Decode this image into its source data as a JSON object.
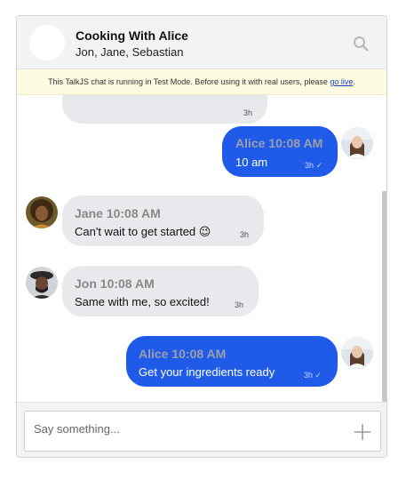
{
  "header": {
    "title": "Cooking With Alice",
    "participants": "Jon, Jane, Sebastian"
  },
  "banner": {
    "text": "This TalkJS chat is running in Test Mode. Before using it with real users, please ",
    "link": "go live",
    "suffix": "."
  },
  "messages": [
    {
      "time": "3h"
    },
    {
      "sender": "Alice",
      "time_sent": "10:08 AM",
      "text": "10 am",
      "time": "3h ✓"
    },
    {
      "sender": "Jane",
      "time_sent": "10:08 AM",
      "text": "Can't wait to get started 😉",
      "time": "3h"
    },
    {
      "sender": "Jon",
      "time_sent": "10:08 AM",
      "text": "Same with me, so excited!",
      "time": "3h"
    },
    {
      "sender": "Alice",
      "time_sent": "10:08 AM",
      "text": "Get your ingredients ready",
      "time": "3h ✓"
    }
  ],
  "composer": {
    "placeholder": "Say something..."
  },
  "colors": {
    "outgoing_bubble": "#1f5ae8",
    "incoming_bubble": "#e7e9ec",
    "banner_bg": "#fdfbe0",
    "header_bg": "#f2f3f5"
  },
  "icons": [
    "search-icon",
    "plus-icon"
  ]
}
